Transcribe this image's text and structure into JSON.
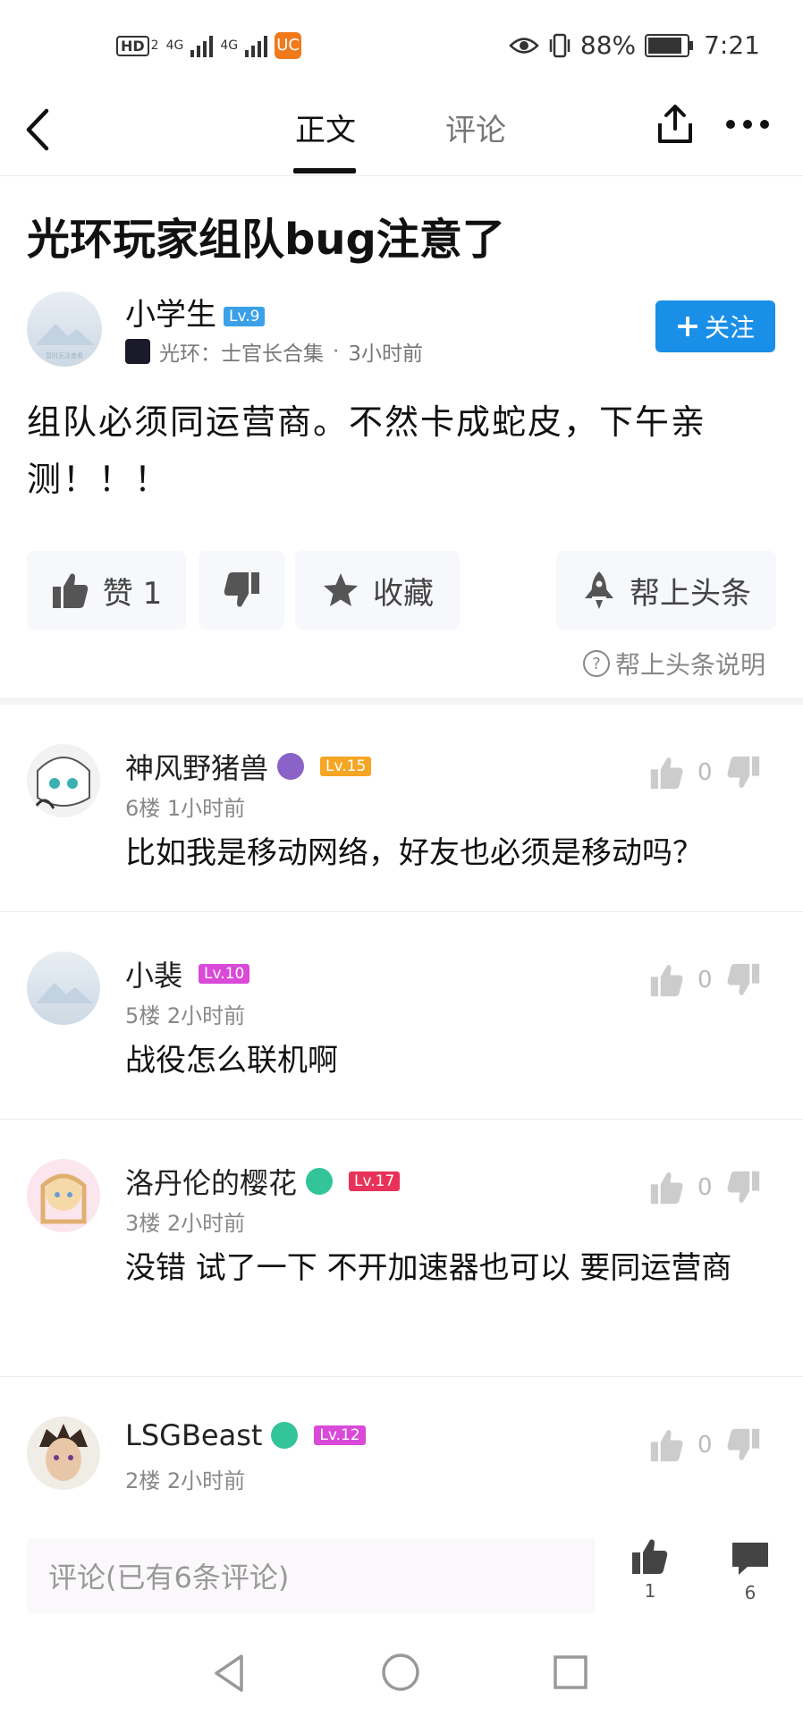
{
  "status_bar": {
    "hd_badge": "HD",
    "hd_sub": "2",
    "net1": "4G",
    "net2": "4G",
    "uc_logo": "UC",
    "battery": "88%",
    "battery_level": 0.88,
    "time": "7:21"
  },
  "nav": {
    "tabs": [
      {
        "label": "正文",
        "active": true
      },
      {
        "label": "评论",
        "active": false
      }
    ]
  },
  "article": {
    "title": "光环玩家组队bug注意了",
    "author": {
      "name": "小学生",
      "level": "Lv.9",
      "level_color": "#3aa0e8",
      "avatar_text": "暂时无法查看"
    },
    "game": "光环：士官长合集",
    "dot": "·",
    "time": "3小时前",
    "follow_label": "关注",
    "body": "组队必须同运营商。不然卡成蛇皮，下午亲测！！！",
    "actions": {
      "like_label": "赞 1",
      "collect_label": "收藏",
      "boost_label": "帮上头条"
    },
    "help_mark": "?",
    "help_note": "帮上头条说明"
  },
  "comments": [
    {
      "name": "神风野猪兽",
      "level": "Lv.15",
      "level_color": "#f5a623",
      "has_badge": true,
      "badge_color": "#8b62c7",
      "floor_time": "6楼 1小时前",
      "text": "比如我是移动网络，好友也必须是移动吗？",
      "likes": "0"
    },
    {
      "name": "小裴",
      "level": "Lv.10",
      "level_color": "#d94ad8",
      "has_badge": false,
      "floor_time": "5楼 2小时前",
      "text": "战役怎么联机啊",
      "likes": "0"
    },
    {
      "name": "洛丹伦的樱花",
      "level": "Lv.17",
      "level_color": "#e8325a",
      "has_badge": true,
      "badge_color": "#33c49a",
      "floor_time": "3楼 2小时前",
      "text": "没错 试了一下 不开加速器也可以 要同运营商",
      "likes": "0"
    },
    {
      "name": "LSGBeast",
      "level": "Lv.12",
      "level_color": "#d94ad8",
      "has_badge": true,
      "badge_color": "#33c49a",
      "floor_time": "2楼 2小时前",
      "text": "",
      "likes": "0"
    }
  ],
  "bottom_bar": {
    "input_placeholder": "评论(已有6条评论)",
    "like_count": "1",
    "comment_count": "6"
  }
}
